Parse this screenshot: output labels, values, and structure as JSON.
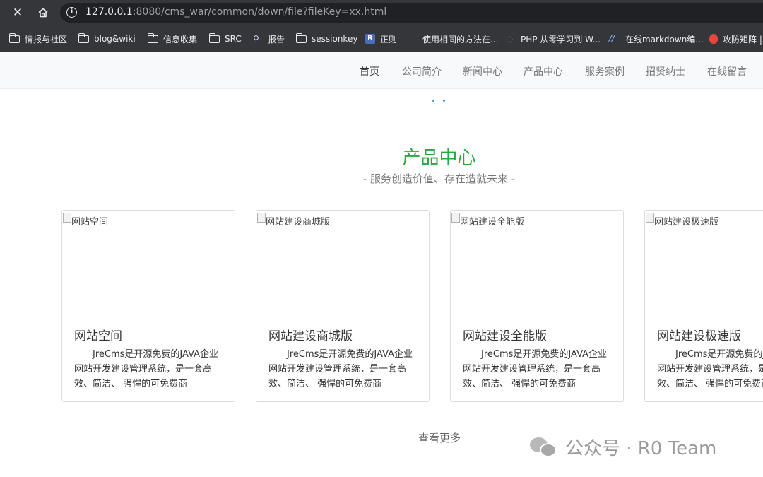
{
  "browser": {
    "url_host": "127.0.0.1",
    "url_rest": ":8080/cms_war/common/down/file?fileKey=xx.html"
  },
  "bookmarks": [
    {
      "label": "情报与社区",
      "icon": "folder-icon"
    },
    {
      "label": "blog&wiki",
      "icon": "folder-icon"
    },
    {
      "label": "信息收集",
      "icon": "folder-icon"
    },
    {
      "label": "SRC",
      "icon": "folder-icon"
    },
    {
      "label": "报告",
      "icon": "search-person-icon"
    },
    {
      "label": "sessionkey",
      "icon": "folder-icon"
    },
    {
      "label": "正则",
      "icon": "r-favicon"
    },
    {
      "label": "使用相同的方法在...",
      "icon": "medium-favicon"
    },
    {
      "label": "PHP 从零学习到 W...",
      "icon": "php-favicon"
    },
    {
      "label": "在线markdown编...",
      "icon": "markdown-favicon"
    },
    {
      "label": "攻防矩阵 |",
      "icon": "fire-favicon"
    }
  ],
  "nav": [
    "首页",
    "公司简介",
    "新闻中心",
    "产品中心",
    "服务案例",
    "招贤纳士",
    "在线留言"
  ],
  "section": {
    "title": "产品中心",
    "subtitle": "- 服务创造价值、存在造就未来 -"
  },
  "products": [
    {
      "alt": "网站空间",
      "title": "网站空间",
      "desc": "JreCms是开源免费的JAVA企业网站开发建设管理系统，是一套高效、简洁、 强悍的可免费商"
    },
    {
      "alt": "网站建设商城版",
      "title": "网站建设商城版",
      "desc": "JreCms是开源免费的JAVA企业网站开发建设管理系统，是一套高效、简洁、 强悍的可免费商"
    },
    {
      "alt": "网站建设全能版",
      "title": "网站建设全能版",
      "desc": "JreCms是开源免费的JAVA企业网站开发建设管理系统，是一套高效、简洁、 强悍的可免费商"
    },
    {
      "alt": "网站建设极速版",
      "title": "网站建设极速版",
      "desc": "JreCms是开源免费的JAVA企业网站开发建设管理系统，是一套高效、简洁、 强悍的可免费商"
    }
  ],
  "more_label": "查看更多",
  "watermark": "公众号 · R0 Team",
  "colors": {
    "accent": "#28a745",
    "chrome": "#35363a",
    "omnibox": "#202124"
  }
}
